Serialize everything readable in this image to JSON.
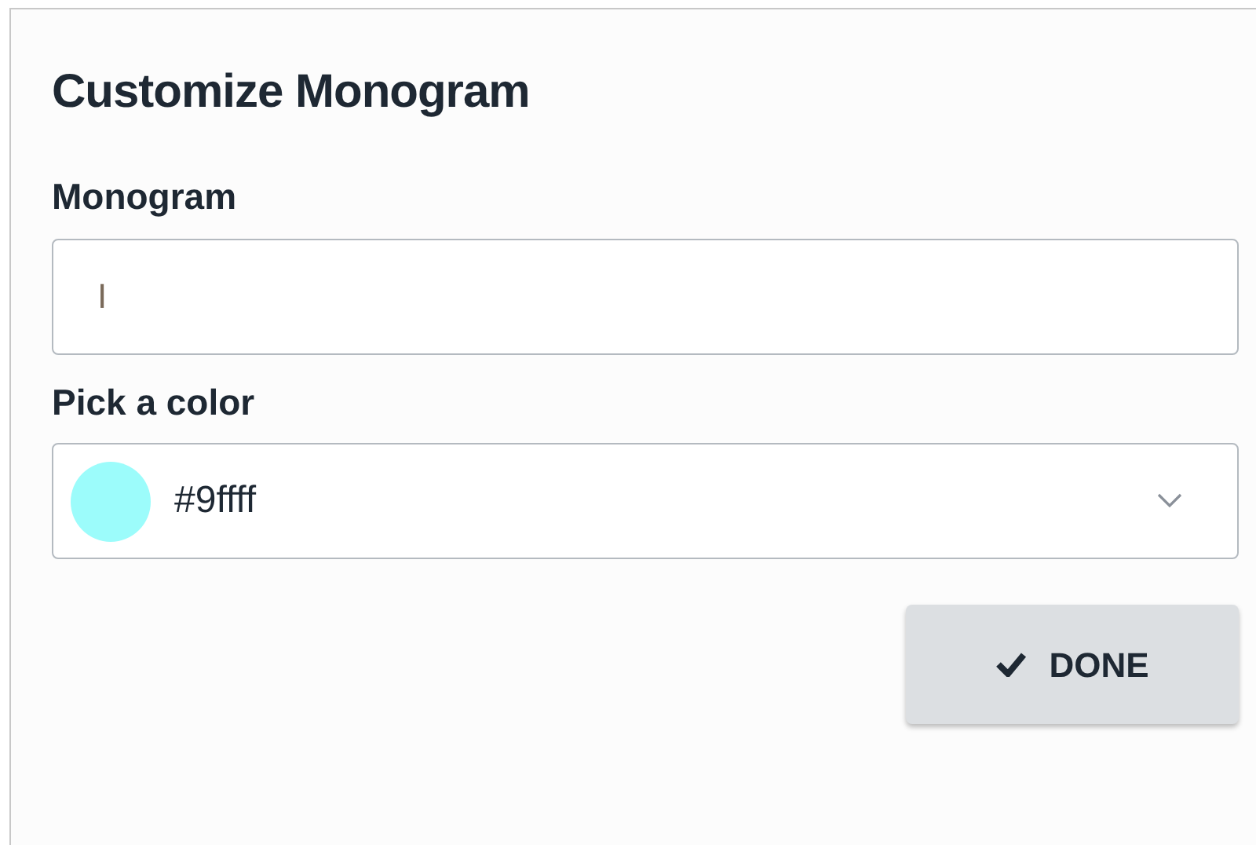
{
  "dialog": {
    "title": "Customize Monogram"
  },
  "monogram": {
    "label": "Monogram",
    "value": "I"
  },
  "color_picker": {
    "label": "Pick a color",
    "value": "#9ffff",
    "color": "#9cfcfb"
  },
  "buttons": [
    {
      "kind": "done",
      "label": "DONE"
    }
  ]
}
